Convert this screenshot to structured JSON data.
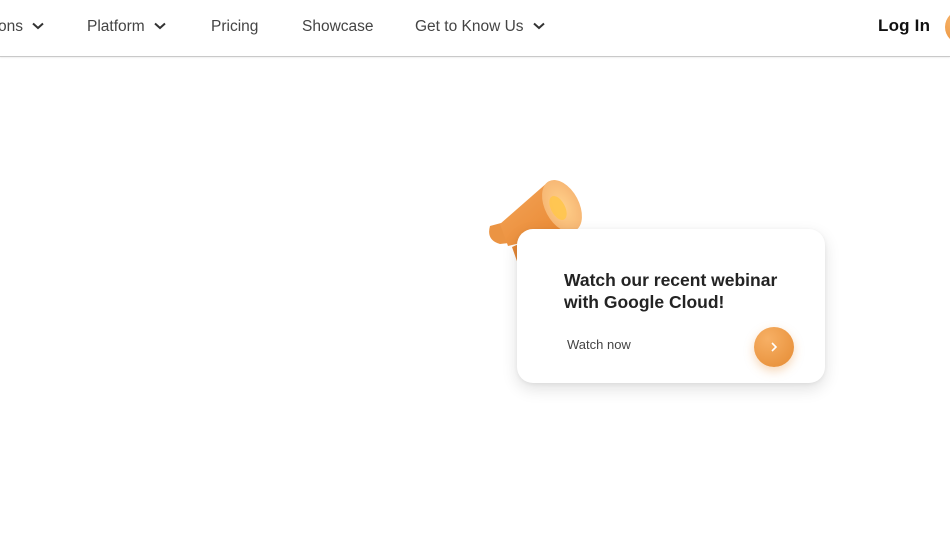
{
  "nav": {
    "items": [
      {
        "label": "ons",
        "has_dropdown": true
      },
      {
        "label": "Platform",
        "has_dropdown": true
      },
      {
        "label": "Pricing",
        "has_dropdown": false
      },
      {
        "label": "Showcase",
        "has_dropdown": false
      },
      {
        "label": "Get to Know Us",
        "has_dropdown": true
      }
    ],
    "login_label": "Log In",
    "chevron_icon": "chevron-down-icon"
  },
  "promo": {
    "icon": "megaphone-icon",
    "title": "Watch our recent webinar with Google Cloud!",
    "link_label": "Watch now",
    "button_icon": "chevron-right-icon"
  },
  "colors": {
    "accent": "#EB9443",
    "text_dark": "#232323",
    "nav_text": "#444444"
  }
}
